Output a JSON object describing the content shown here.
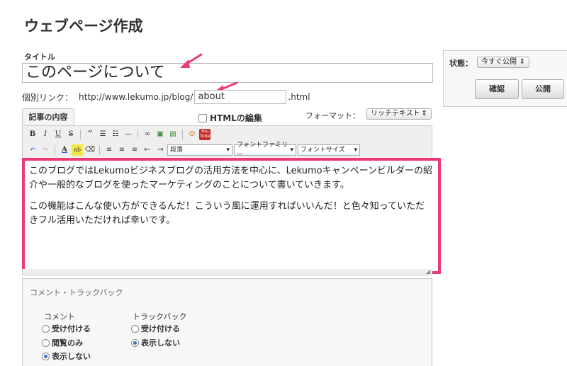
{
  "page": {
    "title": "ウェブページ作成"
  },
  "form": {
    "title_label": "タイトル",
    "title_value": "このページについて",
    "permalink_label": "個別リンク：",
    "permalink_base": "http://www.lekumo.jp/blog/",
    "permalink_slug": "about",
    "permalink_ext": ".html"
  },
  "editor": {
    "tab_label": "記事の内容",
    "html_toggle_label": "HTMLの編集",
    "format_label": "フォーマット：",
    "format_value": "リッチテキスト",
    "paragraph_select": "段落",
    "font_family_select": "フォントファミリー",
    "font_size_select": "フォントサイズ",
    "body_paragraphs": [
      "このブログではLekumoビジネスブログの活用方法を中心に、Lekumoキャンペーンビルダーの紹介や一般的なブログを使ったマーケティングのことについて書いていきます。",
      "この機能はこんな使い方ができるんだ！こういう風に運用すればいいんだ！と色々知っていただきフル活用いただければ幸いです。"
    ],
    "toolbar_row1": [
      {
        "label": "B",
        "icon": "bold-icon"
      },
      {
        "label": "I",
        "icon": "italic-icon"
      },
      {
        "label": "U",
        "icon": "underline-icon"
      },
      {
        "label": "S",
        "icon": "strikethrough-icon"
      },
      {
        "label": "“",
        "icon": "blockquote-icon"
      },
      {
        "label": "☰",
        "icon": "bulleted-list-icon"
      },
      {
        "label": "☷",
        "icon": "numbered-list-icon"
      },
      {
        "label": "—",
        "icon": "horizontal-rule-icon"
      },
      {
        "label": "∞",
        "icon": "link-icon"
      },
      {
        "label": "▣",
        "icon": "image-icon"
      },
      {
        "label": "▤",
        "icon": "file-icon"
      },
      {
        "label": "☺",
        "icon": "emoji-icon"
      }
    ],
    "youtube_label": "You Tube",
    "toolbar_row2": [
      {
        "label": "↶",
        "icon": "undo-icon"
      },
      {
        "label": "↷",
        "icon": "redo-icon"
      },
      {
        "label": "A",
        "icon": "text-color-icon"
      },
      {
        "label": "ab",
        "icon": "highlight-color-icon"
      },
      {
        "label": "⌫",
        "icon": "eraser-icon"
      },
      {
        "label": "≡",
        "icon": "align-left-icon"
      },
      {
        "label": "≡",
        "icon": "align-center-icon"
      },
      {
        "label": "≡",
        "icon": "align-right-icon"
      },
      {
        "label": "⇤",
        "icon": "outdent-icon"
      },
      {
        "label": "⇥",
        "icon": "indent-icon"
      }
    ]
  },
  "sidebar": {
    "status_label": "状態：",
    "status_value": "今すぐ公開",
    "confirm_label": "確認",
    "publish_label": "公開"
  },
  "trackback": {
    "section_label": "コメント・トラックバック",
    "comment_label": "コメント",
    "comment_options": [
      "受け付ける",
      "閲覧のみ",
      "表示しない"
    ],
    "trackback_label": "トラックバック",
    "trackback_options": [
      "受け付ける",
      "表示しない"
    ]
  },
  "colors": {
    "highlight": "#ec3b73",
    "annotation_arrow": "#ec3b73"
  }
}
